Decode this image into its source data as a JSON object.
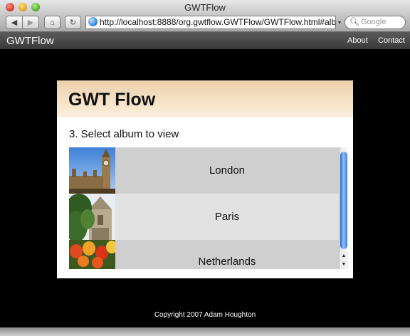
{
  "window": {
    "title": "GWTFlow"
  },
  "browser": {
    "back_icon": "◀",
    "forward_icon": "▶",
    "home_icon": "⌂",
    "reload_icon": "↻",
    "url": "http://localhost:8888/org.gwtflow.GWTFlow/GWTFlow.html#albu",
    "search_placeholder": "Google"
  },
  "appbar": {
    "brand": "GWTFlow",
    "links": [
      "About",
      "Contact"
    ]
  },
  "panel": {
    "title": "GWT Flow",
    "step": "3. Select album to view",
    "albums": [
      {
        "name": "London",
        "thumb": "big-ben-photo"
      },
      {
        "name": "Paris",
        "thumb": "notre-dame-photo"
      },
      {
        "name": "Netherlands",
        "thumb": "tulips-photo"
      }
    ]
  },
  "footer": {
    "text": "Copyright 2007 Adam Houghton"
  }
}
